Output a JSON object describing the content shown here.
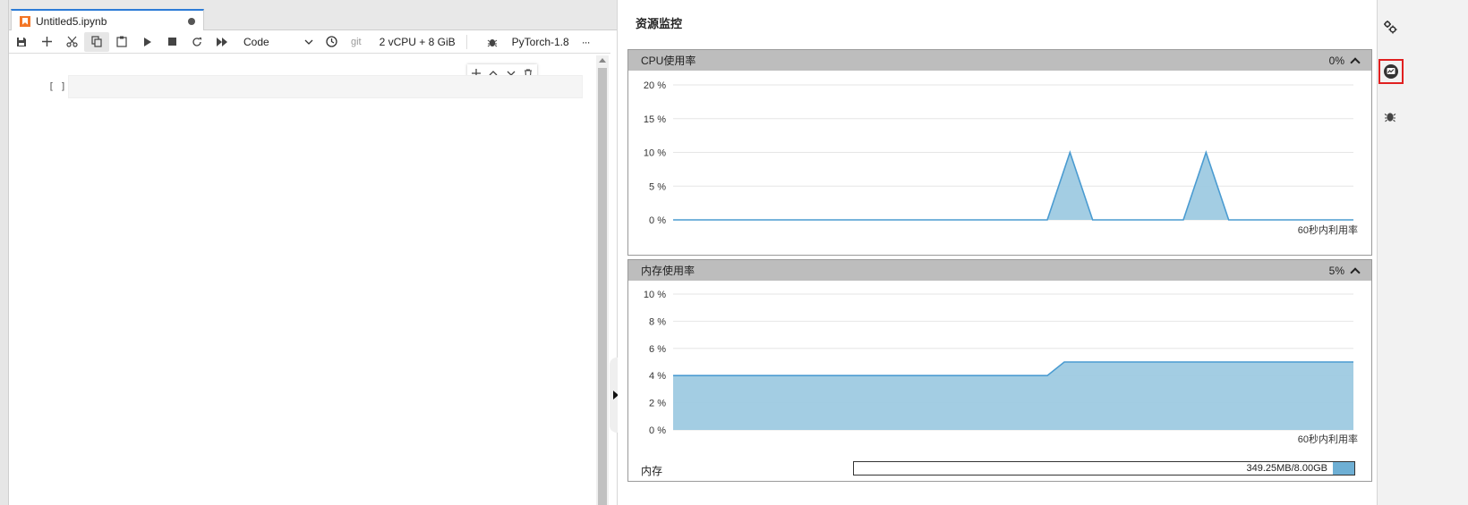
{
  "tab": {
    "title": "Untitled5.ipynb"
  },
  "toolbar": {
    "cell_type": "Code",
    "git": "git",
    "resources": "2 vCPU + 8 GiB",
    "kernel": "PyTorch-1.8",
    "more": "···"
  },
  "cell": {
    "prompt": "[ ]"
  },
  "monitor": {
    "title": "资源监控",
    "cpu": {
      "label": "CPU使用率",
      "value": "0%",
      "footer": "60秒内利用率"
    },
    "memory": {
      "label": "内存使用率",
      "value": "5%",
      "footer": "60秒内利用率",
      "row_label": "内存",
      "usage_text": "349.25MB/8.00GB",
      "usage_fraction": 0.043
    }
  },
  "colors": {
    "area_fill": "#9ecae1",
    "area_line": "#4a9bd1",
    "grid": "#e6e6e6",
    "tab_accent": "#2c7bd6",
    "highlight": "#e02020"
  },
  "chart_data": [
    {
      "type": "area",
      "title": "CPU使用率",
      "xlabel": "60秒内利用率",
      "ylabel": "",
      "ylim": [
        0,
        20
      ],
      "y_ticks": [
        "0 %",
        "5 %",
        "10 %",
        "15 %",
        "20 %"
      ],
      "y_tick_values": [
        0,
        5,
        10,
        15,
        20
      ],
      "grid": true,
      "series": [
        {
          "x": [
            0,
            33,
            35,
            37,
            45,
            47,
            49,
            60
          ],
          "values": [
            0,
            0,
            10,
            0,
            0,
            10,
            0,
            0
          ]
        }
      ]
    },
    {
      "type": "area",
      "title": "内存使用率",
      "xlabel": "60秒内利用率",
      "ylabel": "",
      "ylim": [
        0,
        10
      ],
      "y_ticks": [
        "0 %",
        "2 %",
        "4 %",
        "6 %",
        "8 %",
        "10 %"
      ],
      "y_tick_values": [
        0,
        2,
        4,
        6,
        8,
        10
      ],
      "grid": true,
      "series": [
        {
          "x": [
            0,
            33,
            34.5,
            60
          ],
          "values": [
            4,
            4,
            5,
            5
          ]
        }
      ]
    }
  ]
}
